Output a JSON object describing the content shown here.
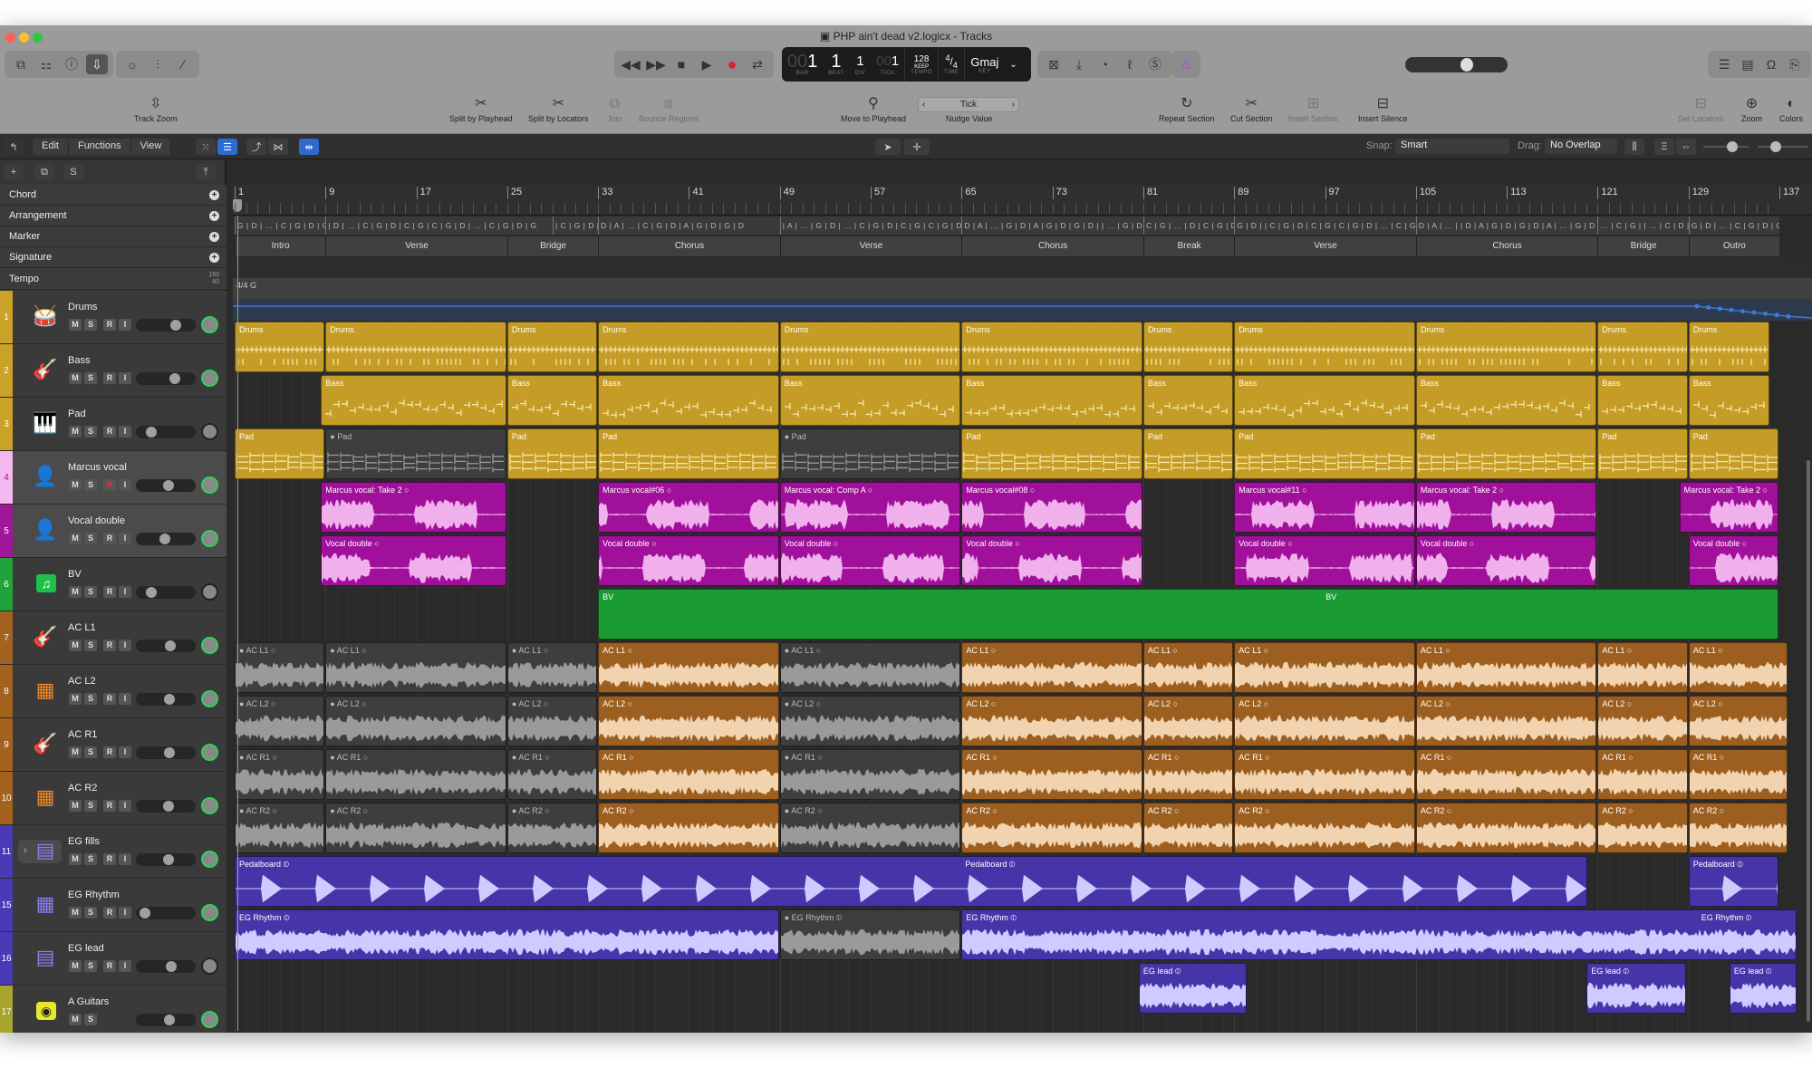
{
  "window": {
    "title": "PHP ain't dead v2.logicx - Tracks",
    "traffic_colors": [
      "#ff5f57",
      "#febc2e",
      "#28c840"
    ]
  },
  "toolbar": {
    "left_icons": [
      "library-icon",
      "inspector-toggle-icon",
      "help-icon",
      "toolbar-download-icon"
    ],
    "edit_icons": [
      "smart-controls-icon",
      "mixer-icon",
      "editor-pencil-icon"
    ],
    "transport": [
      "rewind-icon",
      "fast-forward-icon",
      "stop-icon",
      "play-icon",
      "record-icon",
      "cycle-icon"
    ],
    "lcd": {
      "bar_dim": "00",
      "bar": "1",
      "bar_label": "BAR",
      "beat": "1",
      "beat_label": "BEAT",
      "div": "1",
      "div_label": "DIV",
      "tick_dim": "00",
      "tick": "1",
      "tick_label": "TICK",
      "tempo": "128",
      "tempo_mode": "KEEP",
      "tempo_label": "TEMPO",
      "time_top": "4",
      "time_bottom": "4",
      "time_label": "TIME",
      "key": "Gmaj",
      "key_label": "KEY"
    },
    "right_icons": [
      "count-in-icon",
      "tuner-import-icon",
      "cpu-icon",
      "tuning-fork-icon",
      "solo-icon"
    ],
    "metronome_color": "#a845d8",
    "master_volume": 0.62,
    "view_icons": [
      "list-icon",
      "notepad-icon",
      "loops-icon",
      "browser-icon"
    ]
  },
  "actions": [
    {
      "label": "Track Zoom",
      "icon": "⇳",
      "enabled": true
    },
    {
      "label": "Split by Playhead",
      "icon": "✂",
      "enabled": true
    },
    {
      "label": "Split by Locators",
      "icon": "✂",
      "enabled": true
    },
    {
      "label": "Join",
      "icon": "⧉",
      "enabled": false
    },
    {
      "label": "Bounce Regions",
      "icon": "⧈",
      "enabled": false
    },
    {
      "label": "Move to Playhead",
      "icon": "⚲",
      "enabled": true
    },
    {
      "label": "Nudge Value",
      "icon": "",
      "enabled": true
    },
    {
      "label": "Repeat Section",
      "icon": "↻",
      "enabled": true
    },
    {
      "label": "Cut Section",
      "icon": "✂",
      "enabled": true
    },
    {
      "label": "Insert Section",
      "icon": "⊞",
      "enabled": false
    },
    {
      "label": "Insert Silence",
      "icon": "⊟",
      "enabled": true
    },
    {
      "label": "Set Locators",
      "icon": "⊟",
      "enabled": false
    },
    {
      "label": "Zoom",
      "icon": "⊕",
      "enabled": true
    },
    {
      "label": "Colors",
      "icon": "🎨",
      "enabled": true
    }
  ],
  "nudge": {
    "value": "Tick"
  },
  "tracks_bar": {
    "menus": [
      "Edit",
      "Functions",
      "View"
    ],
    "snap_label": "Snap:",
    "snap_value": "Smart",
    "drag_label": "Drag:",
    "drag_value": "No Overlap"
  },
  "global_tracks": [
    {
      "name": "Chord"
    },
    {
      "name": "Arrangement"
    },
    {
      "name": "Marker"
    },
    {
      "name": "Signature"
    },
    {
      "name": "Tempo",
      "max": "150",
      "min": "80"
    }
  ],
  "ruler": {
    "bars": [
      "1",
      "9",
      "17",
      "25",
      "33",
      "41",
      "49",
      "57",
      "65",
      "73",
      "81",
      "89",
      "97",
      "105",
      "113",
      "121",
      "129",
      "137"
    ]
  },
  "signature": {
    "time": "4/4",
    "key": "G"
  },
  "chords": [
    {
      "start": 1,
      "end": 9,
      "text": "G | D | … | C | G | D | C | G"
    },
    {
      "start": 9,
      "end": 29,
      "text": "| D | … | C | G | D | C | G | C | G | D | … | C | G | D | G"
    },
    {
      "start": 29,
      "end": 33,
      "text": "| C | G | D | … | C | D | G"
    },
    {
      "start": 33,
      "end": 49,
      "text": "D | A | … | C | G | D | A | G | D | G | D"
    },
    {
      "start": 49,
      "end": 65,
      "text": "| A | … | G | D | … | C | G | D | C | G | C | G | D | C | G | C |  | D | … | C | G | D | G"
    },
    {
      "start": 65,
      "end": 81,
      "text": "D | A | … | G | D | A | G | D | G | D |  | … | G | D | A | D"
    },
    {
      "start": 81,
      "end": 89,
      "text": "C | G | … | D | C | G | D | G"
    },
    {
      "start": 89,
      "end": 105,
      "text": "G | D |  | C | G | D | C | G | C | G | D | … | C | G | D | G"
    },
    {
      "start": 105,
      "end": 121,
      "text": "D | A | … |  | D | A | G | D | G | D | A | … | G | D | A | D"
    },
    {
      "start": 121,
      "end": 129,
      "text": "… | C | G |  | … | C | D | G"
    },
    {
      "start": 129,
      "end": 137,
      "text": "G | D | … | C | G | D | C | G"
    }
  ],
  "arrangement": [
    {
      "start": 1,
      "end": 11,
      "label": "Intro"
    },
    {
      "start": 11,
      "end": 31,
      "label": "Verse"
    },
    {
      "start": 31,
      "end": 41,
      "label": "Bridge"
    },
    {
      "start": 41,
      "end": 61,
      "label": "Chorus"
    },
    {
      "start": 61,
      "end": 81,
      "label": "Verse"
    },
    {
      "start": 81,
      "end": 101,
      "label": "Chorus"
    },
    {
      "start": 101,
      "end": 111,
      "label": "Break"
    },
    {
      "start": 111,
      "end": 131,
      "label": "Verse"
    },
    {
      "start": 131,
      "end": 151,
      "label": "Chorus"
    },
    {
      "start": 151,
      "end": 161,
      "label": "Bridge"
    },
    {
      "start": 161,
      "end": 171,
      "label": "Outro"
    }
  ],
  "tracks": [
    {
      "num": "1",
      "name": "Drums",
      "color": "#c9a227",
      "icon": "drum-kit-icon",
      "glyph": "🥁",
      "rec": false,
      "vol": 0.72,
      "pan_active": true,
      "hl": false
    },
    {
      "num": "2",
      "name": "Bass",
      "color": "#c9a227",
      "icon": "bass-guitar-icon",
      "glyph": "🎸",
      "rec": false,
      "vol": 0.7,
      "pan_active": true,
      "hl": false
    },
    {
      "num": "3",
      "name": "Pad",
      "color": "#c9a227",
      "icon": "keyboard-icon",
      "glyph": "🎹",
      "rec": false,
      "vol": 0.2,
      "pan_active": false,
      "hl": false
    },
    {
      "num": "4",
      "name": "Marcus vocal",
      "color": "#f4b8f0",
      "icon": "vocalist-icon",
      "glyph": "👤",
      "rec": true,
      "vol": 0.55,
      "pan_active": true,
      "hl": true
    },
    {
      "num": "5",
      "name": "Vocal double",
      "color": "#a0169a",
      "icon": "vocalist-icon",
      "glyph": "👤",
      "rec": false,
      "vol": 0.48,
      "pan_active": true,
      "hl": true
    },
    {
      "num": "6",
      "name": "BV",
      "color": "#1fa33a",
      "icon": "music-note-icon",
      "glyph": "♫",
      "rec": false,
      "vol": 0.2,
      "pan_active": false,
      "hl": false
    },
    {
      "num": "7",
      "name": "AC L1",
      "color": "#a3621e",
      "icon": "acoustic-guitar-icon",
      "glyph": "🎸",
      "rec": false,
      "vol": 0.6,
      "pan_active": true,
      "hl": false
    },
    {
      "num": "8",
      "name": "AC L2",
      "color": "#a3621e",
      "icon": "amp-icon",
      "glyph": "▦",
      "rec": false,
      "vol": 0.57,
      "pan_active": true,
      "hl": false
    },
    {
      "num": "9",
      "name": "AC R1",
      "color": "#a3621e",
      "icon": "acoustic-guitar-icon",
      "glyph": "🎸",
      "rec": false,
      "vol": 0.57,
      "pan_active": true,
      "hl": false
    },
    {
      "num": "10",
      "name": "AC R2",
      "color": "#a3621e",
      "icon": "amp-icon",
      "glyph": "▦",
      "rec": false,
      "vol": 0.55,
      "pan_active": true,
      "hl": false
    },
    {
      "num": "11",
      "name": "EG fills",
      "color": "#4a3ab5",
      "icon": "stack-amp-icon",
      "glyph": "▤",
      "rec": false,
      "vol": 0.55,
      "pan_active": true,
      "hl": false,
      "folder": true
    },
    {
      "num": "15",
      "name": "EG Rhythm",
      "color": "#4a3ab5",
      "icon": "amp-icon",
      "glyph": "▦",
      "rec": false,
      "vol": 0.05,
      "pan_active": true,
      "hl": false
    },
    {
      "num": "16",
      "name": "EG lead",
      "color": "#4a3ab5",
      "icon": "stack-amp-icon",
      "glyph": "▤",
      "rec": false,
      "vol": 0.62,
      "pan_active": false,
      "hl": false
    },
    {
      "num": "17",
      "name": "A Guitars",
      "color": "#a6a42c",
      "icon": "summing-stack-icon",
      "glyph": "◉",
      "rec": false,
      "vol": 0.58,
      "pan_active": true,
      "hl": false,
      "noRI": true
    }
  ],
  "regions": [
    {
      "t": 0,
      "s": 1,
      "e": 11,
      "name": "Drums",
      "type": "midi",
      "muted": false
    },
    {
      "t": 0,
      "s": 11,
      "e": 31,
      "name": "Drums",
      "type": "midi"
    },
    {
      "t": 0,
      "s": 31,
      "e": 41,
      "name": "Drums",
      "type": "midi"
    },
    {
      "t": 0,
      "s": 41,
      "e": 61,
      "name": "Drums",
      "type": "midi"
    },
    {
      "t": 0,
      "s": 61,
      "e": 81,
      "name": "Drums",
      "type": "midi"
    },
    {
      "t": 0,
      "s": 81,
      "e": 101,
      "name": "Drums",
      "type": "midi"
    },
    {
      "t": 0,
      "s": 101,
      "e": 111,
      "name": "Drums",
      "type": "midi"
    },
    {
      "t": 0,
      "s": 111,
      "e": 131,
      "name": "Drums",
      "type": "midi"
    },
    {
      "t": 0,
      "s": 131,
      "e": 151,
      "name": "Drums",
      "type": "midi"
    },
    {
      "t": 0,
      "s": 151,
      "e": 161,
      "name": "Drums",
      "type": "midi"
    },
    {
      "t": 0,
      "s": 161,
      "e": 170,
      "name": "Drums",
      "type": "midi"
    },
    {
      "t": 1,
      "s": 10.5,
      "e": 31,
      "name": "Bass",
      "type": "midi"
    },
    {
      "t": 1,
      "s": 31,
      "e": 41,
      "name": "Bass",
      "type": "midi"
    },
    {
      "t": 1,
      "s": 41,
      "e": 61,
      "name": "Bass",
      "type": "midi"
    },
    {
      "t": 1,
      "s": 61,
      "e": 81,
      "name": "Bass",
      "type": "midi"
    },
    {
      "t": 1,
      "s": 81,
      "e": 101,
      "name": "Bass",
      "type": "midi"
    },
    {
      "t": 1,
      "s": 101,
      "e": 111,
      "name": "Bass",
      "type": "midi"
    },
    {
      "t": 1,
      "s": 111,
      "e": 131,
      "name": "Bass",
      "type": "midi"
    },
    {
      "t": 1,
      "s": 131,
      "e": 151,
      "name": "Bass",
      "type": "midi"
    },
    {
      "t": 1,
      "s": 151,
      "e": 161,
      "name": "Bass",
      "type": "midi"
    },
    {
      "t": 1,
      "s": 161,
      "e": 170,
      "name": "Bass",
      "type": "midi"
    },
    {
      "t": 2,
      "s": 1,
      "e": 11,
      "name": "Pad",
      "type": "midi"
    },
    {
      "t": 2,
      "s": 11,
      "e": 31,
      "name": "Pad",
      "type": "midi",
      "muted": true
    },
    {
      "t": 2,
      "s": 31,
      "e": 41,
      "name": "Pad",
      "type": "midi"
    },
    {
      "t": 2,
      "s": 41,
      "e": 61,
      "name": "Pad",
      "type": "midi"
    },
    {
      "t": 2,
      "s": 61,
      "e": 81,
      "name": "Pad",
      "type": "midi",
      "muted": true
    },
    {
      "t": 2,
      "s": 81,
      "e": 101,
      "name": "Pad",
      "type": "midi"
    },
    {
      "t": 2,
      "s": 101,
      "e": 111,
      "name": "Pad",
      "type": "midi"
    },
    {
      "t": 2,
      "s": 111,
      "e": 131,
      "name": "Pad",
      "type": "midi"
    },
    {
      "t": 2,
      "s": 131,
      "e": 151,
      "name": "Pad",
      "type": "midi"
    },
    {
      "t": 2,
      "s": 151,
      "e": 161,
      "name": "Pad",
      "type": "midi"
    },
    {
      "t": 2,
      "s": 161,
      "e": 171,
      "name": "Pad",
      "type": "midi"
    },
    {
      "t": 3,
      "s": 10.5,
      "e": 31,
      "name": "Marcus vocal: Take 2",
      "type": "audio"
    },
    {
      "t": 3,
      "s": 41,
      "e": 61,
      "name": "Marcus vocal#06",
      "type": "audio"
    },
    {
      "t": 3,
      "s": 61,
      "e": 81,
      "name": "Marcus vocal: Comp A",
      "type": "audio"
    },
    {
      "t": 3,
      "s": 81,
      "e": 101,
      "name": "Marcus vocal#08",
      "type": "audio"
    },
    {
      "t": 3,
      "s": 111,
      "e": 131,
      "name": "Marcus vocal#11",
      "type": "audio"
    },
    {
      "t": 3,
      "s": 131,
      "e": 151,
      "name": "Marcus vocal: Take 2",
      "type": "audio"
    },
    {
      "t": 3,
      "s": 160,
      "e": 171,
      "name": "Marcus vocal: Take 2",
      "type": "audio"
    },
    {
      "t": 4,
      "s": 10.5,
      "e": 31,
      "name": "Vocal double",
      "type": "audio"
    },
    {
      "t": 4,
      "s": 41,
      "e": 61,
      "name": "Vocal double",
      "type": "audio"
    },
    {
      "t": 4,
      "s": 61,
      "e": 81,
      "name": "Vocal double",
      "type": "audio"
    },
    {
      "t": 4,
      "s": 81,
      "e": 101,
      "name": "Vocal double",
      "type": "audio"
    },
    {
      "t": 4,
      "s": 111,
      "e": 131,
      "name": "Vocal double",
      "type": "audio"
    },
    {
      "t": 4,
      "s": 131,
      "e": 151,
      "name": "Vocal double",
      "type": "audio"
    },
    {
      "t": 4,
      "s": 161,
      "e": 171,
      "name": "Vocal double",
      "type": "audio"
    },
    {
      "t": 5,
      "s": 41,
      "e": 171,
      "name": "BV",
      "type": "stack",
      "label2": "BV"
    },
    {
      "t": 6,
      "s": 1,
      "e": 11,
      "name": "AC L1",
      "type": "audio",
      "muted": true
    },
    {
      "t": 6,
      "s": 11,
      "e": 31,
      "name": "AC L1",
      "type": "audio",
      "muted": true
    },
    {
      "t": 6,
      "s": 31,
      "e": 41,
      "name": "AC L1",
      "type": "audio",
      "muted": true
    },
    {
      "t": 6,
      "s": 41,
      "e": 61,
      "name": "AC L1",
      "type": "audio"
    },
    {
      "t": 6,
      "s": 61,
      "e": 81,
      "name": "AC L1",
      "type": "audio",
      "muted": true
    },
    {
      "t": 6,
      "s": 81,
      "e": 101,
      "name": "AC L1",
      "type": "audio"
    },
    {
      "t": 6,
      "s": 101,
      "e": 111,
      "name": "AC L1",
      "type": "audio"
    },
    {
      "t": 6,
      "s": 111,
      "e": 131,
      "name": "AC L1",
      "type": "audio"
    },
    {
      "t": 6,
      "s": 131,
      "e": 151,
      "name": "AC L1",
      "type": "audio"
    },
    {
      "t": 6,
      "s": 151,
      "e": 161,
      "name": "AC L1",
      "type": "audio"
    },
    {
      "t": 6,
      "s": 161,
      "e": 172,
      "name": "AC L1",
      "type": "audio"
    },
    {
      "t": 7,
      "s": 1,
      "e": 11,
      "name": "AC L2",
      "type": "audio",
      "muted": true
    },
    {
      "t": 7,
      "s": 11,
      "e": 31,
      "name": "AC L2",
      "type": "audio",
      "muted": true
    },
    {
      "t": 7,
      "s": 31,
      "e": 41,
      "name": "AC L2",
      "type": "audio",
      "muted": true
    },
    {
      "t": 7,
      "s": 41,
      "e": 61,
      "name": "AC L2",
      "type": "audio"
    },
    {
      "t": 7,
      "s": 61,
      "e": 81,
      "name": "AC L2",
      "type": "audio",
      "muted": true
    },
    {
      "t": 7,
      "s": 81,
      "e": 101,
      "name": "AC L2",
      "type": "audio"
    },
    {
      "t": 7,
      "s": 101,
      "e": 111,
      "name": "AC L2",
      "type": "audio"
    },
    {
      "t": 7,
      "s": 111,
      "e": 131,
      "name": "AC L2",
      "type": "audio"
    },
    {
      "t": 7,
      "s": 131,
      "e": 151,
      "name": "AC L2",
      "type": "audio"
    },
    {
      "t": 7,
      "s": 151,
      "e": 161,
      "name": "AC L2",
      "type": "audio"
    },
    {
      "t": 7,
      "s": 161,
      "e": 172,
      "name": "AC L2",
      "type": "audio"
    },
    {
      "t": 8,
      "s": 1,
      "e": 11,
      "name": "AC R1",
      "type": "audio",
      "muted": true
    },
    {
      "t": 8,
      "s": 11,
      "e": 31,
      "name": "AC R1",
      "type": "audio",
      "muted": true
    },
    {
      "t": 8,
      "s": 31,
      "e": 41,
      "name": "AC R1",
      "type": "audio",
      "muted": true
    },
    {
      "t": 8,
      "s": 41,
      "e": 61,
      "name": "AC R1",
      "type": "audio"
    },
    {
      "t": 8,
      "s": 61,
      "e": 81,
      "name": "AC R1",
      "type": "audio",
      "muted": true
    },
    {
      "t": 8,
      "s": 81,
      "e": 101,
      "name": "AC R1",
      "type": "audio"
    },
    {
      "t": 8,
      "s": 101,
      "e": 111,
      "name": "AC R1",
      "type": "audio"
    },
    {
      "t": 8,
      "s": 111,
      "e": 131,
      "name": "AC R1",
      "type": "audio"
    },
    {
      "t": 8,
      "s": 131,
      "e": 151,
      "name": "AC R1",
      "type": "audio"
    },
    {
      "t": 8,
      "s": 151,
      "e": 161,
      "name": "AC R1",
      "type": "audio"
    },
    {
      "t": 8,
      "s": 161,
      "e": 172,
      "name": "AC R1",
      "type": "audio"
    },
    {
      "t": 9,
      "s": 1,
      "e": 11,
      "name": "AC R2",
      "type": "audio",
      "muted": true
    },
    {
      "t": 9,
      "s": 11,
      "e": 31,
      "name": "AC R2",
      "type": "audio",
      "muted": true
    },
    {
      "t": 9,
      "s": 31,
      "e": 41,
      "name": "AC R2",
      "type": "audio",
      "muted": true
    },
    {
      "t": 9,
      "s": 41,
      "e": 61,
      "name": "AC R2",
      "type": "audio"
    },
    {
      "t": 9,
      "s": 61,
      "e": 81,
      "name": "AC R2",
      "type": "audio",
      "muted": true
    },
    {
      "t": 9,
      "s": 81,
      "e": 101,
      "name": "AC R2",
      "type": "audio"
    },
    {
      "t": 9,
      "s": 101,
      "e": 111,
      "name": "AC R2",
      "type": "audio"
    },
    {
      "t": 9,
      "s": 111,
      "e": 131,
      "name": "AC R2",
      "type": "audio"
    },
    {
      "t": 9,
      "s": 131,
      "e": 151,
      "name": "AC R2",
      "type": "audio"
    },
    {
      "t": 9,
      "s": 151,
      "e": 161,
      "name": "AC R2",
      "type": "audio"
    },
    {
      "t": 9,
      "s": 161,
      "e": 172,
      "name": "AC R2",
      "type": "audio"
    },
    {
      "t": 10,
      "s": 1,
      "e": 150,
      "name": "Pedalboard",
      "type": "audio",
      "label2": "Pedalboard",
      "label2_at": 81
    },
    {
      "t": 10,
      "s": 161,
      "e": 171,
      "name": "Pedalboard",
      "type": "audio"
    },
    {
      "t": 11,
      "s": 1,
      "e": 61,
      "name": "EG Rhythm",
      "type": "audio"
    },
    {
      "t": 11,
      "s": 61,
      "e": 81,
      "name": "EG Rhythm",
      "type": "audio",
      "muted": true
    },
    {
      "t": 11,
      "s": 81,
      "e": 173,
      "name": "EG Rhythm",
      "type": "audio",
      "label2": "EG Rhythm",
      "label2_at": 162
    },
    {
      "t": 12,
      "s": 100.5,
      "e": 112.5,
      "name": "EG lead",
      "type": "audio"
    },
    {
      "t": 12,
      "s": 149.8,
      "e": 160.8,
      "name": "EG lead",
      "type": "audio"
    },
    {
      "t": 12,
      "s": 165.5,
      "e": 173,
      "name": "EG lead",
      "type": "audio"
    }
  ],
  "colors": {
    "midi_yellow": "#c59c26",
    "audio_magenta": "#a0109a",
    "vocal_wave": "#f0b0ec",
    "bv_green": "#1a9b34",
    "ac_brown": "#9c5f20",
    "ac_wave": "#f2d3b0",
    "eg_purple": "#4535a8",
    "eg_wave": "#cfcaff",
    "muted_bg": "#3e3e3e",
    "muted_wave": "#9a9a9a",
    "tempo_blue": "#3a7bd5"
  }
}
